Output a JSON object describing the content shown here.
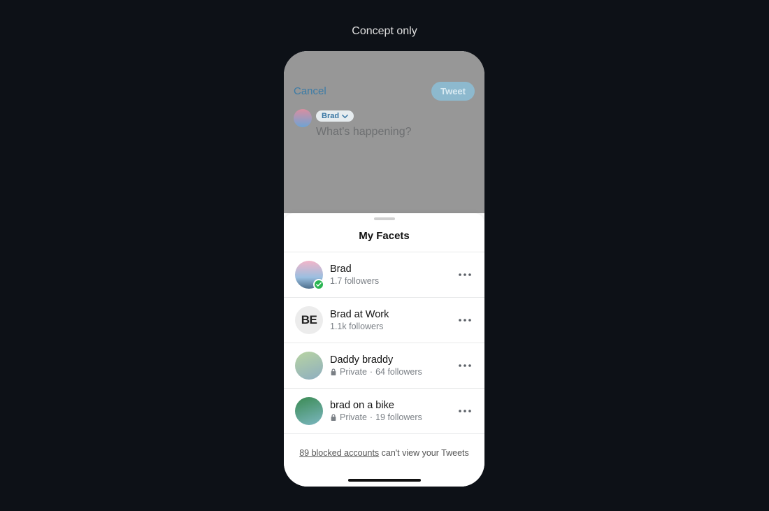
{
  "caption": "Concept only",
  "compose": {
    "cancel": "Cancel",
    "tweet": "Tweet",
    "persona_chip": "Brad",
    "placeholder": "What's happening?"
  },
  "sheet": {
    "title": "My Facets",
    "facets": [
      {
        "name": "Brad",
        "followers": "1.7 followers",
        "private": false,
        "selected": true,
        "avatar_label": "",
        "avatar_class": "av-brad"
      },
      {
        "name": "Brad at Work",
        "followers": "1.1k followers",
        "private": false,
        "selected": false,
        "avatar_label": "BE",
        "avatar_class": "av-work"
      },
      {
        "name": "Daddy braddy",
        "followers": "64 followers",
        "private": true,
        "private_label": "Private",
        "selected": false,
        "avatar_label": "",
        "avatar_class": "av-daddy"
      },
      {
        "name": "brad on a bike",
        "followers": "19 followers",
        "private": true,
        "private_label": "Private",
        "selected": false,
        "avatar_label": "",
        "avatar_class": "av-bike"
      }
    ],
    "blocked_link": "89 blocked accounts",
    "blocked_rest": " can't view your Tweets"
  }
}
